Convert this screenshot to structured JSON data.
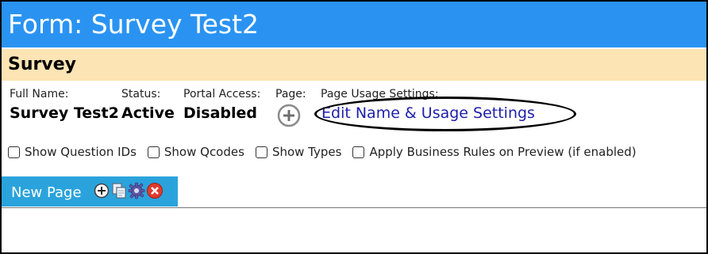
{
  "header": {
    "title": "Form: Survey Test2"
  },
  "section": {
    "title": "Survey"
  },
  "fields": {
    "full_name": {
      "label": "Full Name:",
      "value": "Survey Test2"
    },
    "status": {
      "label": "Status:",
      "value": "Active"
    },
    "portal_access": {
      "label": "Portal Access:",
      "value": "Disabled"
    },
    "page": {
      "label": "Page:",
      "icon": "plus-circle-icon"
    },
    "usage": {
      "label": "Page Usage Settings:",
      "link": "Edit Name & Usage Settings"
    }
  },
  "options": [
    {
      "label": "Show Question IDs",
      "checked": false
    },
    {
      "label": "Show Qcodes",
      "checked": false
    },
    {
      "label": "Show Types",
      "checked": false
    },
    {
      "label": "Apply Business Rules on Preview (if enabled)",
      "checked": false
    }
  ],
  "page_tab": {
    "label": "New Page",
    "icons": [
      "add-icon",
      "copy-icon",
      "settings-icon",
      "delete-icon"
    ]
  },
  "colors": {
    "title_bar": "#2a93f2",
    "section_bar": "#fde4b4",
    "link": "#1d1fa8",
    "tab": "#2aa3dc",
    "delete": "#e03a2e"
  }
}
